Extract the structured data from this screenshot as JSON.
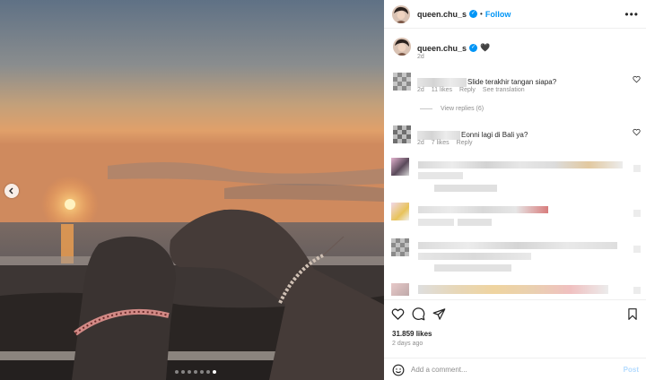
{
  "post": {
    "username": "queen.chu_s",
    "follow_label": "Follow",
    "more_label": "•••",
    "caption_emoji": "🖤",
    "caption_time": "2d",
    "likes": "31.859 likes",
    "posted_ago": "2 days ago",
    "carousel_total": 7,
    "carousel_active": 7
  },
  "comments": [
    {
      "text": "Slide terakhir tangan siapa?",
      "time": "2d",
      "likes": "11 likes",
      "reply_label": "Reply",
      "translate_label": "See translation"
    },
    {
      "text": "Eonni lagi di Bali ya?",
      "time": "2d",
      "likes": "7 likes",
      "reply_label": "Reply"
    }
  ],
  "view_replies_label": "View replies (6)",
  "add_comment": {
    "placeholder": "Add a comment...",
    "post_label": "Post"
  },
  "icons": [
    "chevron-left-icon",
    "verified-badge-icon",
    "more-icon",
    "heart-icon",
    "comment-icon",
    "share-icon",
    "bookmark-icon",
    "emoji-icon"
  ],
  "colors": {
    "accent": "#0095f6",
    "muted": "#8e8e8e",
    "text": "#262626",
    "post_disabled": "#b3dbff"
  }
}
